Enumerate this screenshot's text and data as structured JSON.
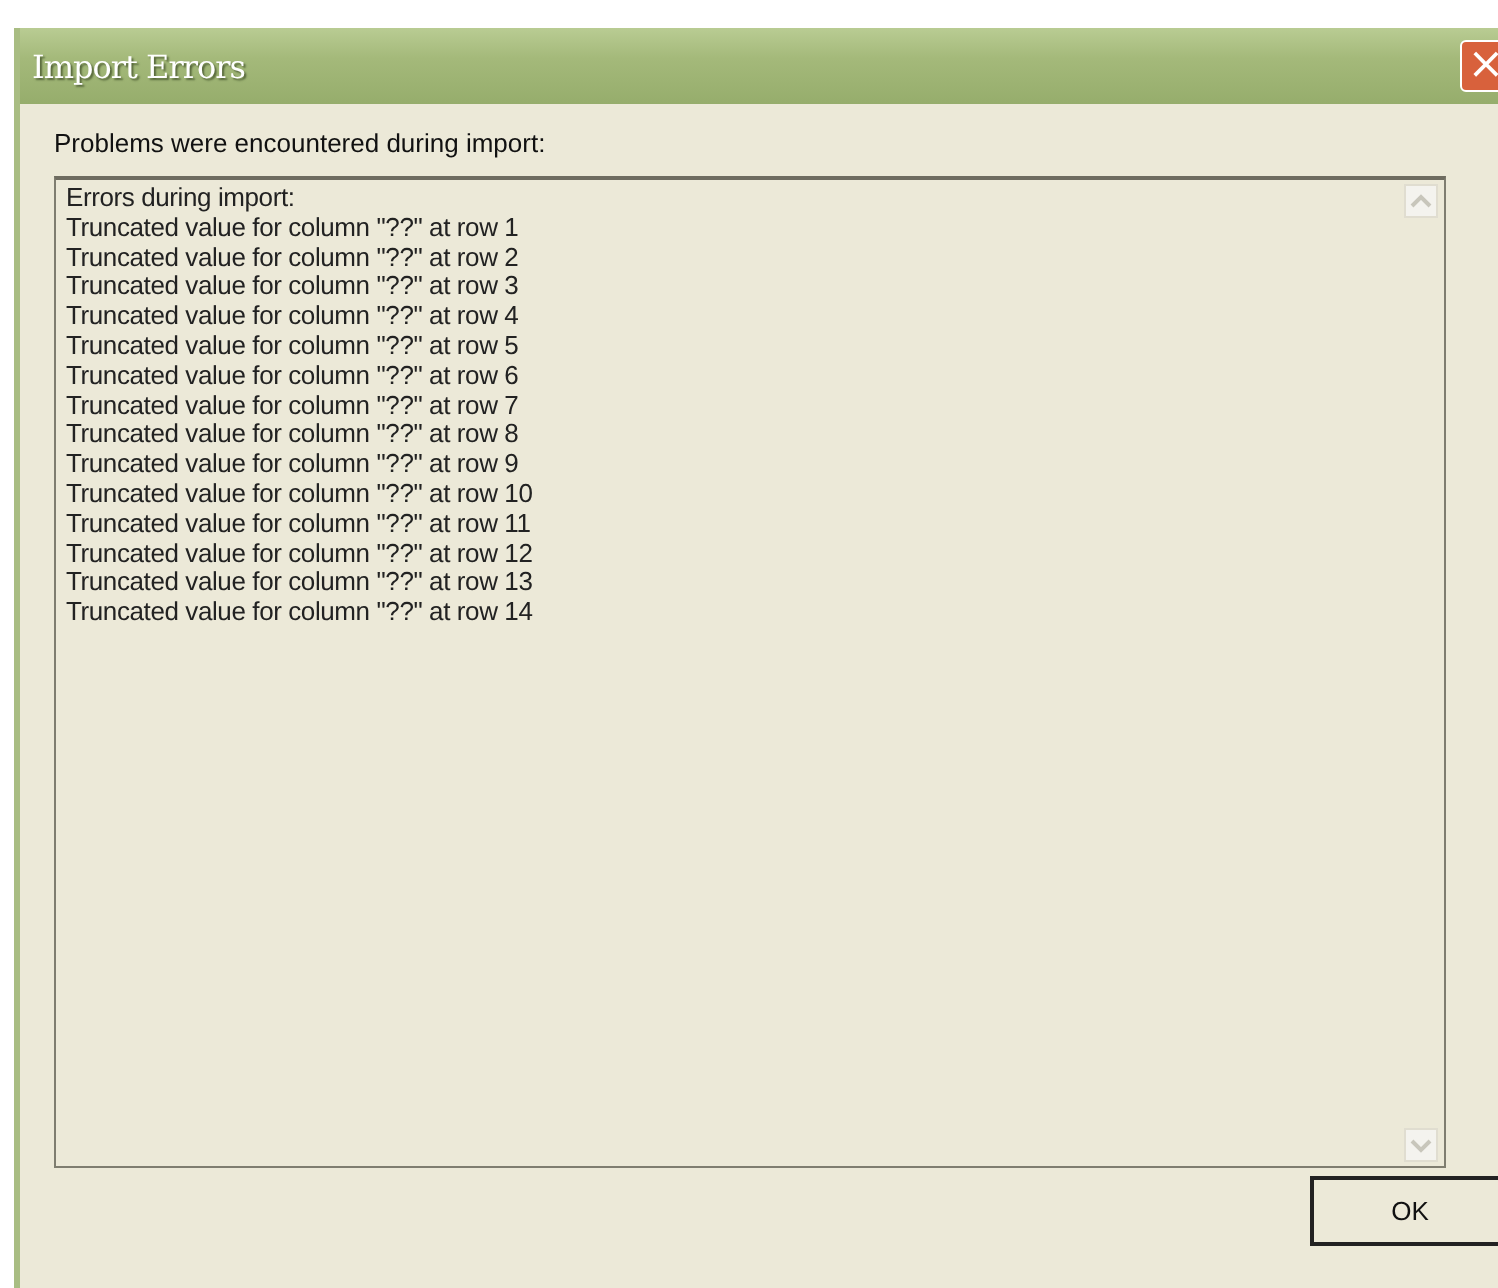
{
  "window": {
    "title": "Import Errors",
    "close_label": "×"
  },
  "message": "Problems were encountered during import:",
  "log_lines": [
    "Errors during import:",
    "Truncated value for column \"??\" at row 1",
    "Truncated value for column \"??\" at row 2",
    "Truncated value for column \"??\" at row 3",
    "Truncated value for column \"??\" at row 4",
    "Truncated value for column \"??\" at row 5",
    "Truncated value for column \"??\" at row 6",
    "Truncated value for column \"??\" at row 7",
    "Truncated value for column \"??\" at row 8",
    "Truncated value for column \"??\" at row 9",
    "Truncated value for column \"??\" at row 10",
    "Truncated value for column \"??\" at row 11",
    "Truncated value for column \"??\" at row 12",
    "Truncated value for column \"??\" at row 13",
    "Truncated value for column \"??\" at row 14"
  ],
  "buttons": [
    "OK"
  ]
}
